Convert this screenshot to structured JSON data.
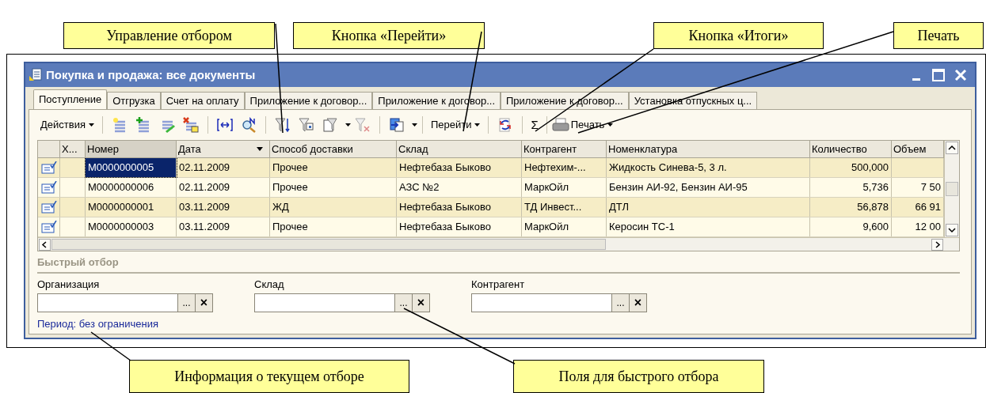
{
  "callouts_top": [
    {
      "text": "Управление отбором"
    },
    {
      "text": "Кнопка «Перейти»"
    },
    {
      "text": "Кнопка «Итоги»"
    },
    {
      "text": "Печать"
    }
  ],
  "callouts_bottom": [
    {
      "text": "Информация о текущем отборе"
    },
    {
      "text": "Поля для быстрого отбора"
    }
  ],
  "window": {
    "title": "Покупка и продажа: все документы"
  },
  "tabs": [
    {
      "label": "Поступление",
      "selected": true
    },
    {
      "label": "Отгрузка",
      "selected": false
    },
    {
      "label": "Счет на оплату",
      "selected": false
    },
    {
      "label": "Приложение к договор...",
      "selected": false
    },
    {
      "label": "Приложение к договор...",
      "selected": false
    },
    {
      "label": "Приложение к договор...",
      "selected": false
    },
    {
      "label": "Установка отпускных ц...",
      "selected": false
    }
  ],
  "toolbar": {
    "actions": "Действия",
    "goto": "Перейти",
    "totals": "Σ",
    "print": "Печать"
  },
  "table": {
    "columns": [
      "Х...",
      "Номер",
      "Дата",
      "Способ доставки",
      "Склад",
      "Контрагент",
      "Номенклатура",
      "Количество",
      "Объем"
    ],
    "rows": [
      {
        "selected": true,
        "cells": [
          "",
          "M0000000005",
          "02.11.2009",
          "Прочее",
          "Нефтебаза Быково",
          "Нефтехим-...",
          "Жидкость Синева-5, 3 л.",
          "500,000",
          ""
        ]
      },
      {
        "selected": false,
        "cells": [
          "",
          "M0000000006",
          "02.11.2009",
          "Прочее",
          "АЗС №2",
          "МаркОйл",
          "Бензин АИ-92, Бензин АИ-95",
          "5,736",
          "7 50"
        ]
      },
      {
        "selected": false,
        "cells": [
          "",
          "M0000000001",
          "03.11.2009",
          "ЖД",
          "Нефтебаза Быково",
          "ТД Инвест...",
          "ДТЛ",
          "56,878",
          "66 91"
        ]
      },
      {
        "selected": false,
        "cells": [
          "",
          "M0000000003",
          "03.11.2009",
          "Прочее",
          "Нефтебаза Быково",
          "МаркОйл",
          "Керосин ТС-1",
          "9,600",
          "12 00"
        ]
      }
    ]
  },
  "quick_filter": {
    "title": "Быстрый отбор",
    "fields": [
      {
        "label": "Организация",
        "select": "...",
        "clear": "×"
      },
      {
        "label": "Склад",
        "select": "...",
        "clear": "×"
      },
      {
        "label": "Контрагент",
        "select": "...",
        "clear": "×"
      }
    ],
    "period": "Период: без ограничения"
  }
}
